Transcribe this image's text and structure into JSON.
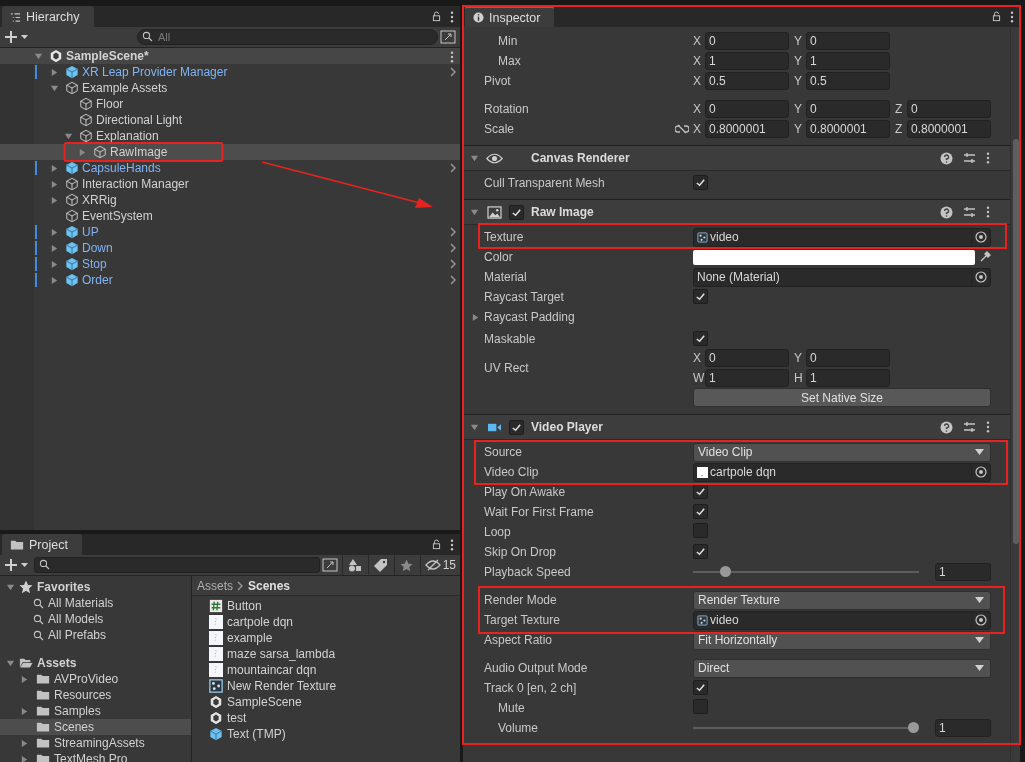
{
  "hierarchy": {
    "tab": "Hierarchy",
    "search": {
      "placeholder": "All"
    },
    "scene": {
      "label": "SampleScene*",
      "expanded": true,
      "children": [
        {
          "label": "XR Leap Provider Manager",
          "kind": "prefab",
          "expanded": false,
          "selected": false
        },
        {
          "label": "Example Assets",
          "kind": "object",
          "expanded": true,
          "selected": false,
          "children": [
            {
              "label": "Floor",
              "kind": "object",
              "selected": false
            },
            {
              "label": "Directional Light",
              "kind": "object",
              "selected": false
            },
            {
              "label": "Explanation",
              "kind": "object",
              "expanded": true,
              "selected": false,
              "children": [
                {
                  "label": "RawImage",
                  "kind": "object",
                  "expanded": false,
                  "selected": true
                }
              ]
            }
          ]
        },
        {
          "label": "CapsuleHands",
          "kind": "prefab",
          "expanded": false,
          "selected": false
        },
        {
          "label": "Interaction Manager",
          "kind": "object",
          "expanded": false,
          "selected": false
        },
        {
          "label": "XRRig",
          "kind": "object",
          "expanded": false,
          "selected": false
        },
        {
          "label": "EventSystem",
          "kind": "object",
          "selected": false
        },
        {
          "label": "UP",
          "kind": "prefab",
          "expanded": false,
          "selected": false
        },
        {
          "label": "Down",
          "kind": "prefab",
          "expanded": false,
          "selected": false
        },
        {
          "label": "Stop",
          "kind": "prefab",
          "expanded": false,
          "selected": false
        },
        {
          "label": "Order",
          "kind": "prefab",
          "expanded": false,
          "selected": false
        }
      ]
    }
  },
  "project": {
    "tab": "Project",
    "hidden_count": "15",
    "favorites": {
      "label": "Favorites",
      "expanded": true,
      "items": [
        "All Materials",
        "All Models",
        "All Prefabs"
      ]
    },
    "assets": {
      "label": "Assets",
      "expanded": true,
      "children": [
        {
          "label": "AVProVideo",
          "expanded": false,
          "selected": false
        },
        {
          "label": "Resources",
          "selected": false
        },
        {
          "label": "Samples",
          "expanded": false,
          "selected": false
        },
        {
          "label": "Scenes",
          "selected": true
        },
        {
          "label": "StreamingAssets",
          "expanded": false,
          "selected": false
        },
        {
          "label": "TextMesh Pro",
          "expanded": false,
          "selected": false
        }
      ]
    },
    "breadcrumb": [
      "Assets",
      "Scenes"
    ],
    "files": [
      {
        "label": "Button",
        "kind": "script"
      },
      {
        "label": "cartpole dqn",
        "kind": "video"
      },
      {
        "label": "example",
        "kind": "video"
      },
      {
        "label": "maze sarsa_lambda",
        "kind": "video"
      },
      {
        "label": "mountaincar dqn",
        "kind": "video"
      },
      {
        "label": "New Render Texture",
        "kind": "render_texture"
      },
      {
        "label": "SampleScene",
        "kind": "scene"
      },
      {
        "label": "test",
        "kind": "scene"
      },
      {
        "label": "Text (TMP)",
        "kind": "prefab"
      }
    ]
  },
  "inspector": {
    "tab": "Inspector",
    "rows": [
      {
        "kind": "group",
        "children": [
          {
            "kind": "vector",
            "label": "Min",
            "fields": [
              {
                "axis": "X",
                "value": "0"
              },
              {
                "axis": "Y",
                "value": "0"
              }
            ]
          },
          {
            "kind": "vector",
            "label": "Max",
            "fields": [
              {
                "axis": "X",
                "value": "1"
              },
              {
                "axis": "Y",
                "value": "1"
              }
            ]
          }
        ]
      },
      {
        "kind": "vector",
        "label": "Pivot",
        "fields": [
          {
            "axis": "X",
            "value": "0.5"
          },
          {
            "axis": "Y",
            "value": "0.5"
          }
        ]
      },
      {
        "kind": "vector",
        "label": "Rotation",
        "fields": [
          {
            "axis": "X",
            "value": "0"
          },
          {
            "axis": "Y",
            "value": "0"
          },
          {
            "axis": "Z",
            "value": "0"
          }
        ]
      },
      {
        "kind": "vector",
        "label": "Scale",
        "proportions_locked": false,
        "fields": [
          {
            "axis": "X",
            "value": "0.8000001"
          },
          {
            "axis": "Y",
            "value": "0.8000001"
          },
          {
            "axis": "Z",
            "value": "0.8000001"
          }
        ]
      },
      {
        "kind": "renderer_component",
        "title": "Canvas Renderer",
        "expanded": true
      },
      {
        "kind": "checkbox",
        "label": "Cull Transparent Mesh",
        "checked": true
      },
      {
        "kind": "image_component",
        "title": "Raw Image",
        "expanded": true,
        "enabled": true
      },
      {
        "kind": "texture_ref",
        "label": "Texture",
        "value": "video"
      },
      {
        "kind": "color",
        "label": "Color",
        "color": "#ffffff"
      },
      {
        "kind": "object",
        "label": "Material",
        "value": "None (Material)"
      },
      {
        "kind": "checkbox",
        "label": "Raycast Target",
        "checked": true
      },
      {
        "kind": "foldout",
        "label": "Raycast Padding",
        "expanded": false
      },
      {
        "kind": "checkbox",
        "label": "Maskable",
        "checked": true
      },
      {
        "kind": "vector",
        "label": "UV Rect",
        "fields": [
          {
            "axis": "X",
            "value": "0"
          },
          {
            "axis": "Y",
            "value": "0"
          },
          {
            "axis": "W",
            "value": "1"
          },
          {
            "axis": "H",
            "value": "1"
          }
        ]
      },
      {
        "kind": "button",
        "label": "Set Native Size"
      },
      {
        "kind": "video_component",
        "title": "Video Player",
        "expanded": true,
        "enabled": true
      },
      {
        "kind": "dropdown",
        "label": "Source",
        "value": "Video Clip"
      },
      {
        "kind": "clip_ref",
        "label": "Video Clip",
        "value": "cartpole dqn"
      },
      {
        "kind": "checkbox",
        "label": "Play On Awake",
        "checked": true
      },
      {
        "kind": "checkbox",
        "label": "Wait For First Frame",
        "checked": true
      },
      {
        "kind": "checkbox",
        "label": "Loop",
        "checked": false
      },
      {
        "kind": "checkbox",
        "label": "Skip On Drop",
        "checked": true
      },
      {
        "kind": "slider",
        "label": "Playback Speed",
        "level": 0.12,
        "value": "1"
      },
      {
        "kind": "dropdown",
        "label": "Render Mode",
        "value": "Render Texture"
      },
      {
        "kind": "texture_ref",
        "label": "Target Texture",
        "value": "video"
      },
      {
        "kind": "dropdown",
        "label": "Aspect Ratio",
        "value": "Fit Horizontally"
      },
      {
        "kind": "dropdown",
        "label": "Audio Output Mode",
        "value": "Direct"
      },
      {
        "kind": "checkbox",
        "label": "Track 0 [en, 2 ch]",
        "checked": true,
        "children": [
          {
            "kind": "checkbox",
            "label": "Mute",
            "checked": false
          },
          {
            "kind": "slider",
            "label": "Volume",
            "level": 1,
            "value": "1"
          }
        ]
      }
    ]
  }
}
